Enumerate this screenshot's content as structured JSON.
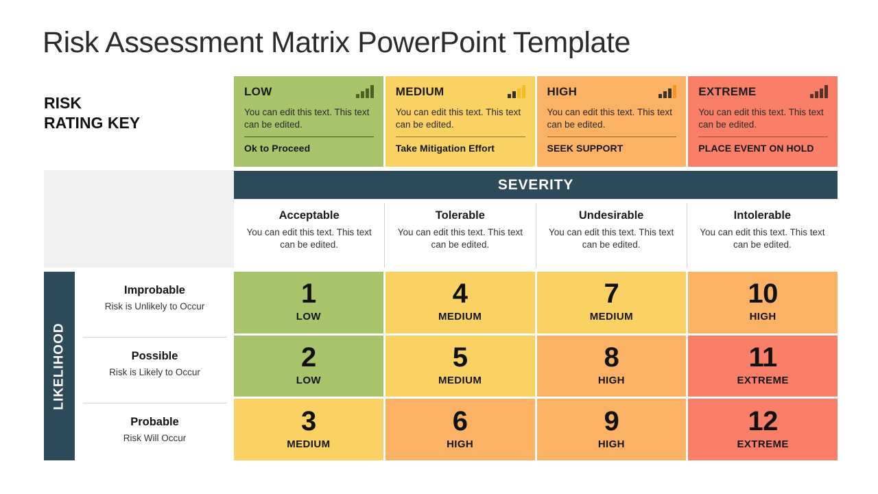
{
  "title": "Risk Assessment Matrix PowerPoint Template",
  "rating_key": {
    "label_line1": "RISK",
    "label_line2": "RATING KEY",
    "cards": [
      {
        "title": "LOW",
        "description": "You can edit this text. This text can be edited.",
        "action": "Ok to Proceed",
        "bg": "#a8c46a",
        "icon": "signal-bars-icon",
        "bar_colors": [
          "#4c6122",
          "#4c6122",
          "#4c6122",
          "#4c6122"
        ],
        "rule_color": "#3f5a1e"
      },
      {
        "title": "MEDIUM",
        "description": "You can edit this text. This text can be edited.",
        "action": "Take Mitigation Effort",
        "bg": "#f9d263",
        "icon": "signal-bars-icon",
        "bar_colors": [
          "#33302a",
          "#33302a",
          "#f5bc23",
          "#f5bc23"
        ],
        "rule_color": "#97752a"
      },
      {
        "title": "HIGH",
        "description": "You can edit this text. This text can be edited.",
        "action": "SEEK SUPPORT",
        "bg": "#fbb264",
        "icon": "signal-bars-icon",
        "bar_colors": [
          "#3a3129",
          "#3a3129",
          "#3a3129",
          "#f79428"
        ],
        "rule_color": "#9a6326"
      },
      {
        "title": "EXTREME",
        "description": "You can edit this text. This text can be edited.",
        "action": "PLACE EVENT ON HOLD",
        "bg": "#fa7f68",
        "icon": "signal-bars-icon",
        "bar_colors": [
          "#57312b",
          "#57312b",
          "#57312b",
          "#57312b"
        ],
        "rule_color": "#a24a3c"
      }
    ]
  },
  "severity": {
    "header": "SEVERITY",
    "header_bg": "#2d4a5a",
    "columns": [
      {
        "title": "Acceptable",
        "description": "You can edit this text. This text can be edited."
      },
      {
        "title": "Tolerable",
        "description": "You can edit this text. This text can be edited."
      },
      {
        "title": "Undesirable",
        "description": "You can edit this text. This text can be edited."
      },
      {
        "title": "Intolerable",
        "description": "You can edit this text. This text can be edited."
      }
    ]
  },
  "likelihood": {
    "header": "LIKELIHOOD",
    "header_bg": "#2d4a5a",
    "rows": [
      {
        "title": "Improbable",
        "description": "Risk is Unlikely to Occur"
      },
      {
        "title": "Possible",
        "description": "Risk is Likely to Occur"
      },
      {
        "title": "Probable",
        "description": "Risk Will Occur"
      }
    ]
  },
  "matrix": {
    "rows": [
      [
        {
          "number": "1",
          "label": "LOW",
          "bg": "#a8c46a"
        },
        {
          "number": "4",
          "label": "MEDIUM",
          "bg": "#f9d263"
        },
        {
          "number": "7",
          "label": "MEDIUM",
          "bg": "#f9d263"
        },
        {
          "number": "10",
          "label": "HIGH",
          "bg": "#fbb264"
        }
      ],
      [
        {
          "number": "2",
          "label": "LOW",
          "bg": "#a8c46a"
        },
        {
          "number": "5",
          "label": "MEDIUM",
          "bg": "#f9d263"
        },
        {
          "number": "8",
          "label": "HIGH",
          "bg": "#fbb264"
        },
        {
          "number": "11",
          "label": "EXTREME",
          "bg": "#fa7f68"
        }
      ],
      [
        {
          "number": "3",
          "label": "MEDIUM",
          "bg": "#f9d263"
        },
        {
          "number": "6",
          "label": "HIGH",
          "bg": "#fbb264"
        },
        {
          "number": "9",
          "label": "HIGH",
          "bg": "#fbb264"
        },
        {
          "number": "12",
          "label": "EXTREME",
          "bg": "#fa7f68"
        }
      ]
    ]
  }
}
